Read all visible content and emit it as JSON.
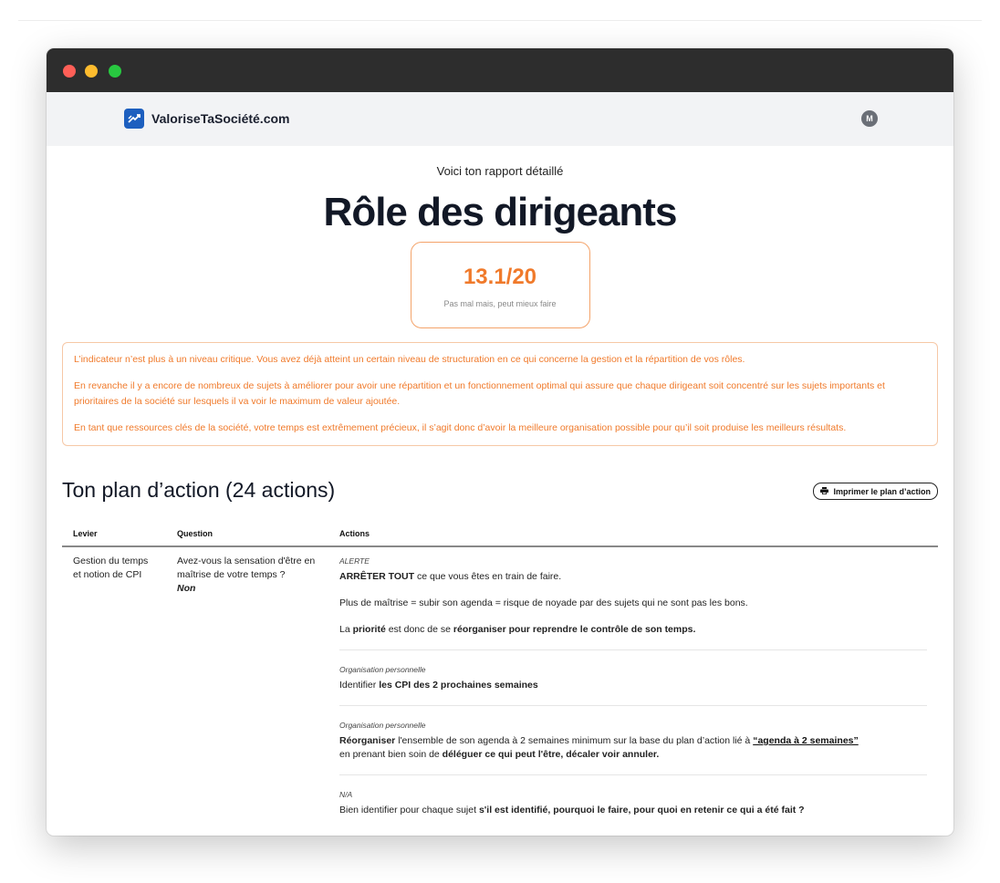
{
  "app": {
    "brand": "ValoriseTaSociété.com",
    "avatar_initial": "M"
  },
  "report": {
    "intro": "Voici ton rapport détaillé",
    "title": "Rôle des dirigeants",
    "score": "13.1/20",
    "score_caption": "Pas mal mais, peut mieux faire"
  },
  "analysis": [
    "L’indicateur n’est plus à un niveau critique. Vous avez déjà atteint un certain niveau de structuration en ce qui concerne la gestion et la répartition de vos rôles.",
    "En revanche il y a encore de nombreux de sujets à améliorer pour avoir une répartition et un fonctionnement optimal qui assure que chaque dirigeant soit concentré sur les sujets importants et prioritaires de la société sur lesquels il va voir le maximum de valeur ajoutée.",
    "En tant que ressources clés de la société, votre temps est extrêmement précieux, il s’agit donc d’avoir la meilleure organisation possible pour qu’il soit produise les meilleurs résultats."
  ],
  "plan": {
    "title": "Ton plan d’action (24 actions)",
    "print_label": "Imprimer le plan d’action",
    "columns": {
      "lever": "Levier",
      "question": "Question",
      "actions": "Actions"
    },
    "row": {
      "lever": "Gestion du temps et notion de CPI",
      "question": "Avez-vous la sensation d'être en maîtrise de votre temps ?",
      "answer": "Non",
      "actions": [
        {
          "category": "ALERTE",
          "p1_bold": "ARRÊTER TOUT",
          "p1_text": " ce que vous êtes en train de faire.",
          "p2": "Plus de maîtrise = subir son agenda = risque de noyade par des sujets qui ne sont pas les bons.",
          "p3_a": "La ",
          "p3_b": "priorité",
          "p3_c": " est donc de se ",
          "p3_d": "réorganiser pour reprendre le contrôle de son temps."
        },
        {
          "category": "Organisation personnelle",
          "p1_text": "Identifier ",
          "p1_bold": "les CPI des 2 prochaines semaines"
        },
        {
          "category": "Organisation personnelle",
          "p1_bold": "Réorganiser",
          "p1_text": " l'ensemble de son agenda à 2 semaines minimum sur la base du plan d’action lié à ",
          "p1_link": "“agenda à 2 semaines”",
          "p2_text": "en prenant bien soin de ",
          "p2_bold": "déléguer ce qui peut l'être, décaler voir annuler."
        },
        {
          "category": "N/A",
          "p1_text": "Bien identifier pour chaque sujet ",
          "p1_bold": "s'il est identifié, pourquoi le faire, pour quoi en retenir ce qui a été fait ?"
        }
      ]
    }
  }
}
